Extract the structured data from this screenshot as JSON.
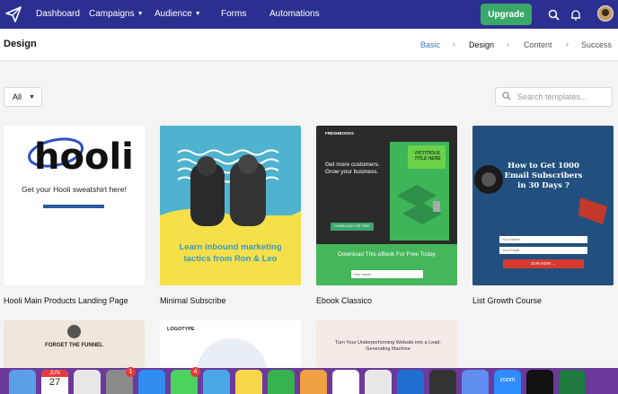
{
  "nav": {
    "items": [
      {
        "label": "Dashboard",
        "has_dropdown": false
      },
      {
        "label": "Campaigns",
        "has_dropdown": true
      },
      {
        "label": "Audience",
        "has_dropdown": true
      },
      {
        "label": "Forms",
        "has_dropdown": false
      },
      {
        "label": "Automations",
        "has_dropdown": false
      }
    ],
    "upgrade_label": "Upgrade",
    "icons": [
      "paper-plane-icon",
      "search-icon",
      "bell-icon",
      "avatar"
    ]
  },
  "header": {
    "title": "Design",
    "steps": [
      "Basic",
      "Design",
      "Content",
      "Success"
    ],
    "active_step": "Design"
  },
  "filters": {
    "category_value": "All",
    "search_placeholder": "Search templates..."
  },
  "templates": [
    {
      "name": "Hooli Main Products Landing Page",
      "thumb_logo": "hooli",
      "thumb_text": "Get your Hooli sweatshirt here!"
    },
    {
      "name": "Minimal Subscribe",
      "thumb_text": "Learn inbound marketing tactics from Ron & Leo"
    },
    {
      "name": "Ebook Classico",
      "thumb_brand": "FRESHBOOKS",
      "thumb_headline": "Get more customers. Grow your business.",
      "thumb_badge": "FICTITIOUS TITLE HERE",
      "thumb_cta": "Download This eBook For Free Today"
    },
    {
      "name": "List Growth Course",
      "thumb_headline": "How to Get 1000 Email Subscribers in 30 Days ?",
      "thumb_cta": "JOIN NOW →"
    },
    {
      "name": "",
      "thumb_text": "FORGET THE FUNNEL"
    },
    {
      "name": "",
      "thumb_text": "LOGOTYPE"
    },
    {
      "name": "",
      "thumb_text": "Turn Your Underperforming Website into a Lead-Generating Machine"
    }
  ],
  "dock": {
    "calendar_month": "JUN",
    "calendar_day": "27",
    "badges": [
      "1",
      "4"
    ],
    "zoom_label": "zoom"
  },
  "colors": {
    "nav_bg": "#2b2f8f",
    "upgrade_bg": "#3aa869",
    "active_step": "#3b7bd0",
    "dock_bg": "#6b3a9a"
  }
}
